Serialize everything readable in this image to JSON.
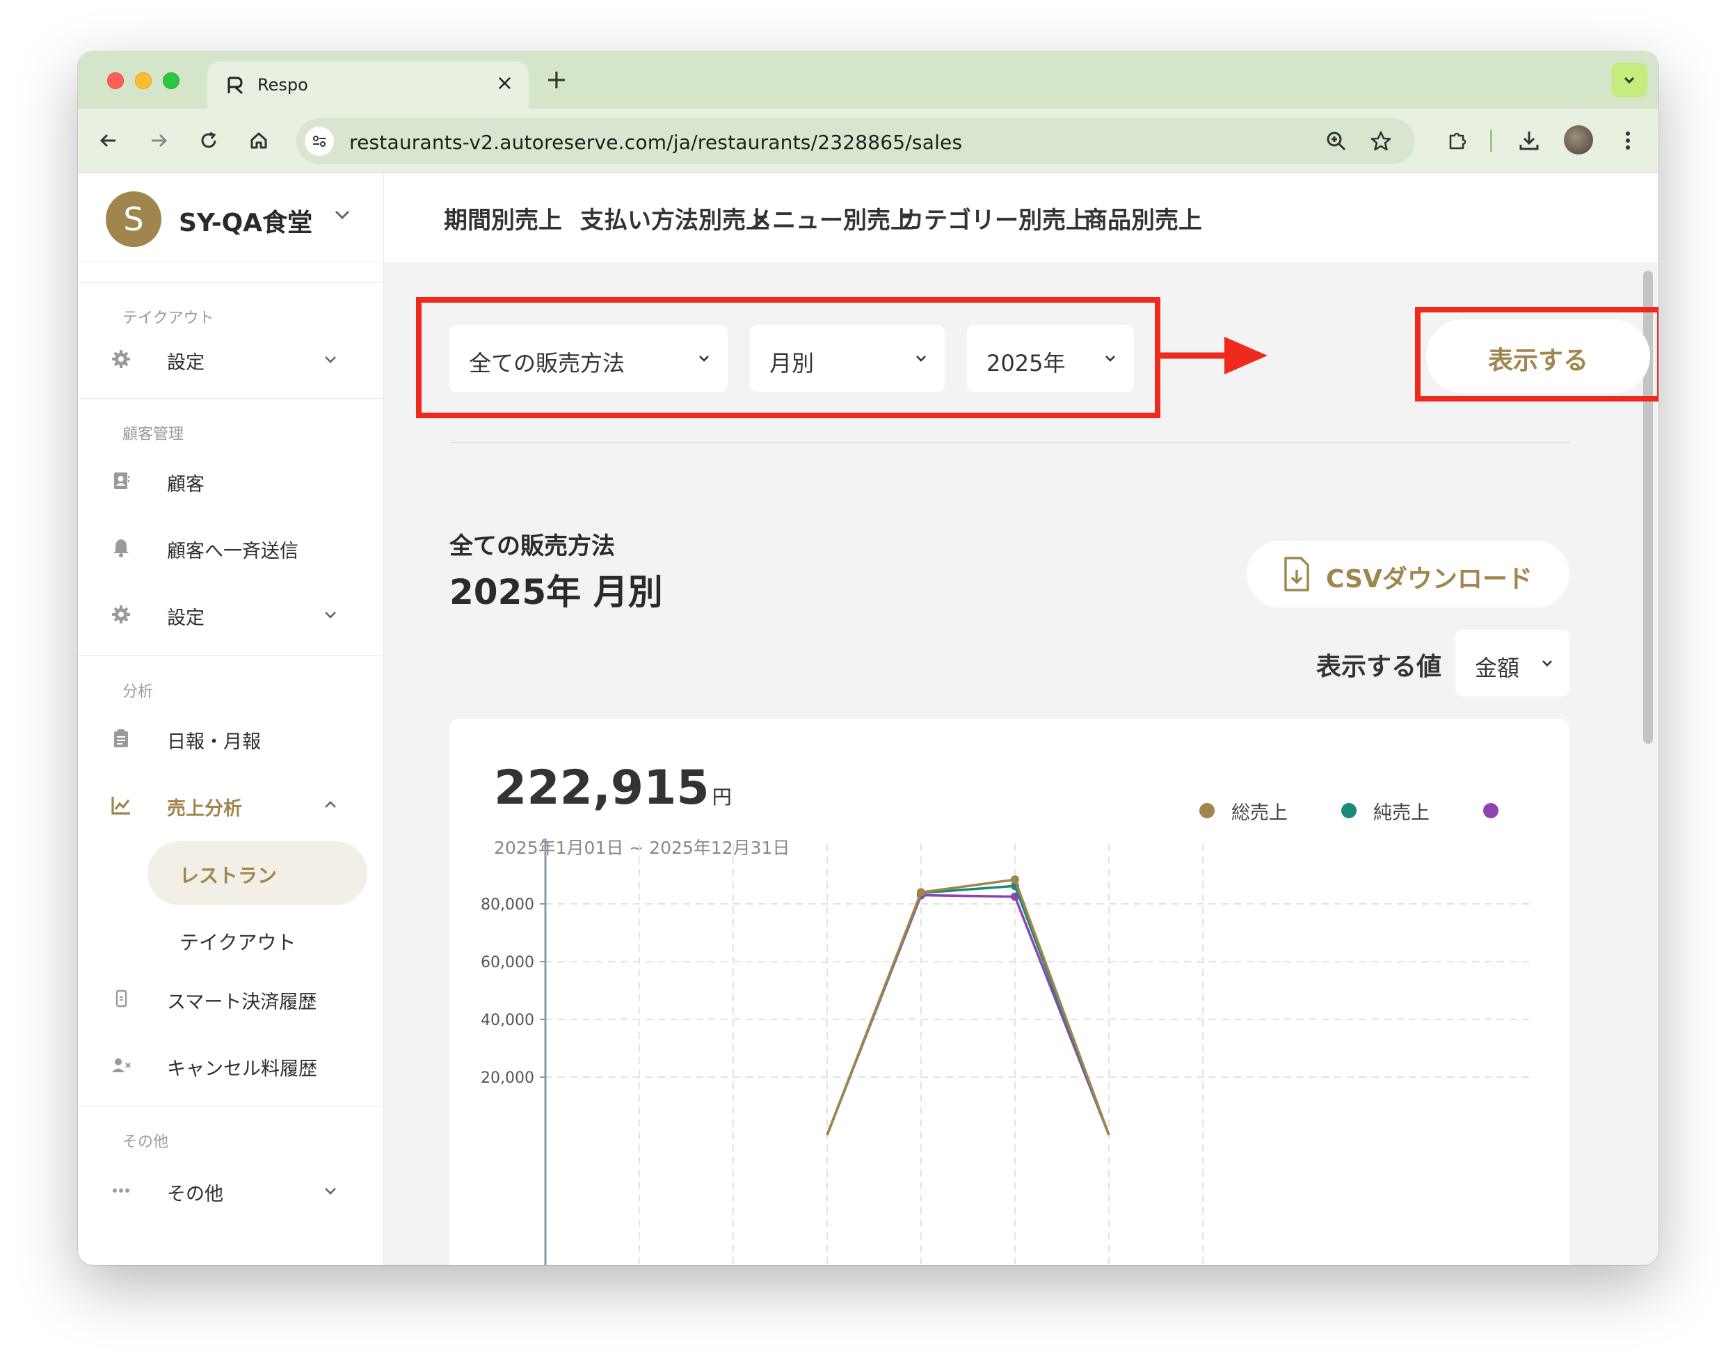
{
  "browser": {
    "tab_title": "Respo",
    "url": "restaurants-v2.autoreserve.com/ja/restaurants/2328865/sales"
  },
  "sidebar": {
    "avatar_letter": "S",
    "restaurant_name": "SY-QA食堂",
    "sections": {
      "takeout": "テイクアウト",
      "customers": "顧客管理",
      "analysis": "分析",
      "other": "その他"
    },
    "items": {
      "takeout_settings": "設定",
      "customers": "顧客",
      "broadcast": "顧客へ一斉送信",
      "customer_settings": "設定",
      "reports": "日報・月報",
      "sales_analysis": "売上分析",
      "sub_restaurant": "レストラン",
      "sub_takeout": "テイクアウト",
      "smart_payment": "スマート決済履歴",
      "cancel_fee": "キャンセル料履歴",
      "other": "その他"
    }
  },
  "report_tabs": [
    "期間別売上",
    "支払い方法別売上",
    "メニュー別売上",
    "カテゴリー別売上",
    "商品別売上"
  ],
  "filters": {
    "method": "全ての販売方法",
    "granularity": "月別",
    "year": "2025年",
    "show_button": "表示する"
  },
  "summary": {
    "method_label": "全ての販売方法",
    "period_label": "2025年 月別",
    "csv_button": "CSVダウンロード",
    "value_label": "表示する値",
    "value_select": "金額"
  },
  "card": {
    "total": "222,915",
    "unit": "円",
    "range": "2025年1月01日 ~ 2025年12月31日",
    "legend": [
      {
        "name": "総売上",
        "color": "#a0854c"
      },
      {
        "name": "純売上",
        "color": "#1a8a7a"
      },
      {
        "name": "",
        "color": "#8e44ad"
      }
    ]
  },
  "colors": {
    "accent": "#a0854c",
    "highlight": "#ee2a1f",
    "gross": "#a0854c",
    "net": "#1a8a7a",
    "third": "#8e44ad"
  },
  "chart_data": {
    "type": "line",
    "x": [
      1,
      2,
      3,
      4,
      5,
      6,
      7,
      8
    ],
    "y_ticks": [
      "80,000",
      "60,000",
      "40,000",
      "20,000"
    ],
    "ylim_visible": [
      20000,
      88000
    ],
    "series": [
      {
        "name": "総売上",
        "values": [
          null,
          null,
          null,
          0,
          84000,
          88400,
          0,
          null
        ]
      },
      {
        "name": "純売上",
        "values": [
          null,
          null,
          null,
          0,
          83800,
          86200,
          0,
          null
        ]
      },
      {
        "name": "",
        "values": [
          null,
          null,
          null,
          0,
          83000,
          82500,
          0,
          null
        ]
      }
    ]
  }
}
